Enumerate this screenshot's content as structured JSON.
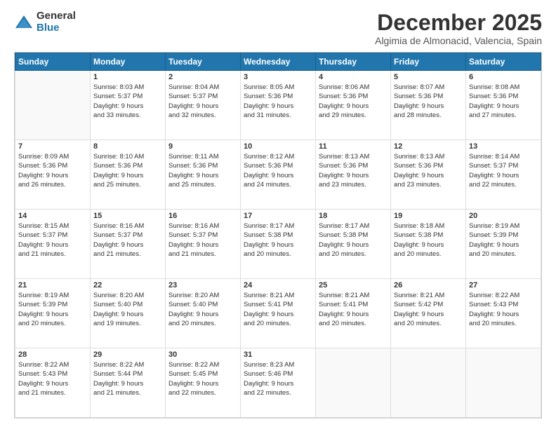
{
  "logo": {
    "general": "General",
    "blue": "Blue"
  },
  "header": {
    "month": "December 2025",
    "location": "Algimia de Almonacid, Valencia, Spain"
  },
  "days": [
    "Sunday",
    "Monday",
    "Tuesday",
    "Wednesday",
    "Thursday",
    "Friday",
    "Saturday"
  ],
  "weeks": [
    [
      {
        "day": "",
        "info": ""
      },
      {
        "day": "1",
        "info": "Sunrise: 8:03 AM\nSunset: 5:37 PM\nDaylight: 9 hours\nand 33 minutes."
      },
      {
        "day": "2",
        "info": "Sunrise: 8:04 AM\nSunset: 5:37 PM\nDaylight: 9 hours\nand 32 minutes."
      },
      {
        "day": "3",
        "info": "Sunrise: 8:05 AM\nSunset: 5:36 PM\nDaylight: 9 hours\nand 31 minutes."
      },
      {
        "day": "4",
        "info": "Sunrise: 8:06 AM\nSunset: 5:36 PM\nDaylight: 9 hours\nand 29 minutes."
      },
      {
        "day": "5",
        "info": "Sunrise: 8:07 AM\nSunset: 5:36 PM\nDaylight: 9 hours\nand 28 minutes."
      },
      {
        "day": "6",
        "info": "Sunrise: 8:08 AM\nSunset: 5:36 PM\nDaylight: 9 hours\nand 27 minutes."
      }
    ],
    [
      {
        "day": "7",
        "info": "Sunrise: 8:09 AM\nSunset: 5:36 PM\nDaylight: 9 hours\nand 26 minutes."
      },
      {
        "day": "8",
        "info": "Sunrise: 8:10 AM\nSunset: 5:36 PM\nDaylight: 9 hours\nand 25 minutes."
      },
      {
        "day": "9",
        "info": "Sunrise: 8:11 AM\nSunset: 5:36 PM\nDaylight: 9 hours\nand 25 minutes."
      },
      {
        "day": "10",
        "info": "Sunrise: 8:12 AM\nSunset: 5:36 PM\nDaylight: 9 hours\nand 24 minutes."
      },
      {
        "day": "11",
        "info": "Sunrise: 8:13 AM\nSunset: 5:36 PM\nDaylight: 9 hours\nand 23 minutes."
      },
      {
        "day": "12",
        "info": "Sunrise: 8:13 AM\nSunset: 5:36 PM\nDaylight: 9 hours\nand 23 minutes."
      },
      {
        "day": "13",
        "info": "Sunrise: 8:14 AM\nSunset: 5:37 PM\nDaylight: 9 hours\nand 22 minutes."
      }
    ],
    [
      {
        "day": "14",
        "info": "Sunrise: 8:15 AM\nSunset: 5:37 PM\nDaylight: 9 hours\nand 21 minutes."
      },
      {
        "day": "15",
        "info": "Sunrise: 8:16 AM\nSunset: 5:37 PM\nDaylight: 9 hours\nand 21 minutes."
      },
      {
        "day": "16",
        "info": "Sunrise: 8:16 AM\nSunset: 5:37 PM\nDaylight: 9 hours\nand 21 minutes."
      },
      {
        "day": "17",
        "info": "Sunrise: 8:17 AM\nSunset: 5:38 PM\nDaylight: 9 hours\nand 20 minutes."
      },
      {
        "day": "18",
        "info": "Sunrise: 8:17 AM\nSunset: 5:38 PM\nDaylight: 9 hours\nand 20 minutes."
      },
      {
        "day": "19",
        "info": "Sunrise: 8:18 AM\nSunset: 5:38 PM\nDaylight: 9 hours\nand 20 minutes."
      },
      {
        "day": "20",
        "info": "Sunrise: 8:19 AM\nSunset: 5:39 PM\nDaylight: 9 hours\nand 20 minutes."
      }
    ],
    [
      {
        "day": "21",
        "info": "Sunrise: 8:19 AM\nSunset: 5:39 PM\nDaylight: 9 hours\nand 20 minutes."
      },
      {
        "day": "22",
        "info": "Sunrise: 8:20 AM\nSunset: 5:40 PM\nDaylight: 9 hours\nand 19 minutes."
      },
      {
        "day": "23",
        "info": "Sunrise: 8:20 AM\nSunset: 5:40 PM\nDaylight: 9 hours\nand 20 minutes."
      },
      {
        "day": "24",
        "info": "Sunrise: 8:21 AM\nSunset: 5:41 PM\nDaylight: 9 hours\nand 20 minutes."
      },
      {
        "day": "25",
        "info": "Sunrise: 8:21 AM\nSunset: 5:41 PM\nDaylight: 9 hours\nand 20 minutes."
      },
      {
        "day": "26",
        "info": "Sunrise: 8:21 AM\nSunset: 5:42 PM\nDaylight: 9 hours\nand 20 minutes."
      },
      {
        "day": "27",
        "info": "Sunrise: 8:22 AM\nSunset: 5:43 PM\nDaylight: 9 hours\nand 20 minutes."
      }
    ],
    [
      {
        "day": "28",
        "info": "Sunrise: 8:22 AM\nSunset: 5:43 PM\nDaylight: 9 hours\nand 21 minutes."
      },
      {
        "day": "29",
        "info": "Sunrise: 8:22 AM\nSunset: 5:44 PM\nDaylight: 9 hours\nand 21 minutes."
      },
      {
        "day": "30",
        "info": "Sunrise: 8:22 AM\nSunset: 5:45 PM\nDaylight: 9 hours\nand 22 minutes."
      },
      {
        "day": "31",
        "info": "Sunrise: 8:23 AM\nSunset: 5:46 PM\nDaylight: 9 hours\nand 22 minutes."
      },
      {
        "day": "",
        "info": ""
      },
      {
        "day": "",
        "info": ""
      },
      {
        "day": "",
        "info": ""
      }
    ]
  ]
}
